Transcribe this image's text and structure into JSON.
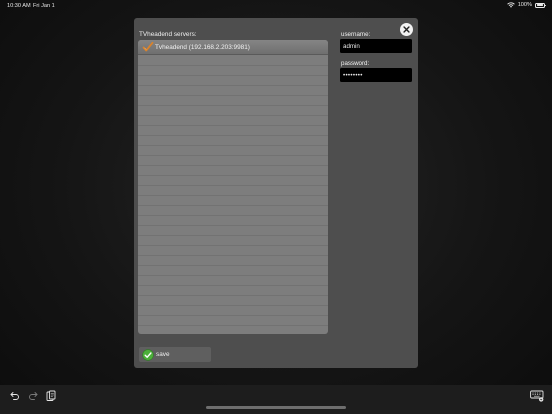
{
  "status_bar": {
    "time": "10:30 AM",
    "date": "Fri Jan 1",
    "battery_text": "100%",
    "icons": [
      "wifi-icon",
      "battery-icon"
    ]
  },
  "dialog": {
    "close_icon": "close-icon",
    "servers_label": "TVheadend servers:",
    "servers": [
      {
        "label": "Tvheadend (192.168.2.203:9981)",
        "selected": true,
        "icon": "check-icon"
      }
    ],
    "username_label": "username:",
    "username_value": "admin",
    "password_label": "password:",
    "password_value": "••••••••",
    "save_label": "save",
    "save_icon": "check-circle-icon"
  },
  "toolbar": {
    "icons": [
      "undo-icon",
      "redo-icon",
      "paste-icon",
      "keyboard-icon"
    ]
  },
  "colors": {
    "dialog_bg": "#4e4e4e",
    "list_bg": "#7d7d7d",
    "input_bg": "#000000",
    "check_green": "#4caf3a",
    "check_orange": "#d9822b"
  }
}
